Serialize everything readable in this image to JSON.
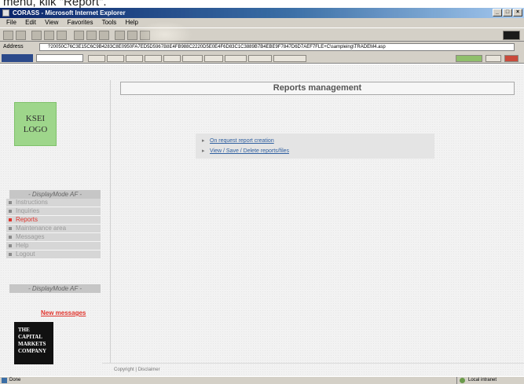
{
  "caption": "menu, klik \"Report\".",
  "window": {
    "title": "CORASS - Microsoft Internet Explorer",
    "menu": [
      "File",
      "Edit",
      "View",
      "Favorites",
      "Tools",
      "Help"
    ]
  },
  "addressbar": {
    "label": "Address",
    "url": "?20050C76C3E15C6C9B4283C8E0950FA7ED5D5967B8E4FB988C2220D5E0E4F6D83C1C3889B7B4EBE9F7847D6D7AEF7FLE+C\\sampleing\\TRADEM4.asp"
  },
  "sidebar": {
    "logo_line1": "KSEI",
    "logo_line2": "LOGO",
    "menu_header": "- DisplayMode AF -",
    "menu_footer": "- DisplayMode AF -",
    "items": [
      {
        "label": "Instructions"
      },
      {
        "label": "Inquiries"
      },
      {
        "label": "Reports"
      },
      {
        "label": "Maintenance area"
      },
      {
        "label": "Messages"
      },
      {
        "label": "Help"
      },
      {
        "label": "Logout"
      }
    ],
    "new_messages": "New messages",
    "bottom_logo": [
      "THE",
      "CAPITAL",
      "MARKETS",
      "COMPANY"
    ]
  },
  "main": {
    "title": "Reports management",
    "links": [
      {
        "label": "On request report creation"
      },
      {
        "label": "View / Save / Delete reports/files"
      }
    ]
  },
  "footer": {
    "copyright": "Copyright | Disclaimer"
  },
  "statusbar": {
    "text": "Done",
    "zone": "Local intranet"
  }
}
